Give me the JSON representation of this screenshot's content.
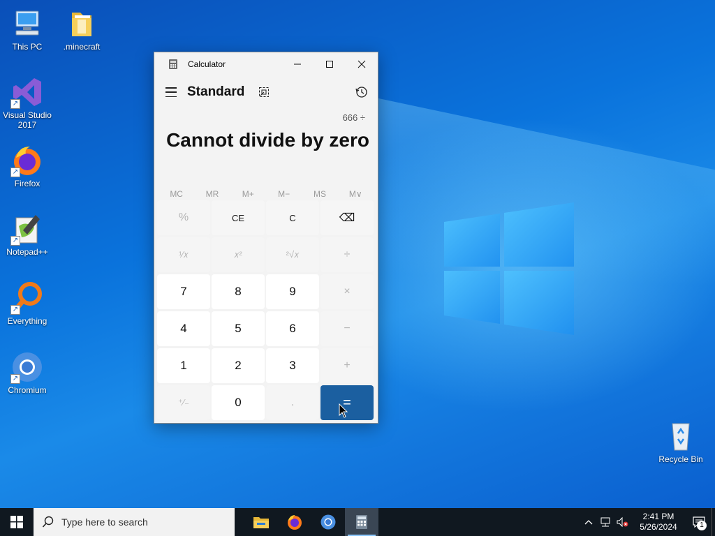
{
  "desktop": {
    "icons": [
      {
        "label": "This PC",
        "icon": "computer-icon"
      },
      {
        "label": ".minecraft",
        "icon": "folder-icon"
      },
      {
        "label": "Visual Studio 2017",
        "icon": "visual-studio-icon"
      },
      {
        "label": "Firefox",
        "icon": "firefox-icon"
      },
      {
        "label": "Notepad++",
        "icon": "notepadpp-icon"
      },
      {
        "label": "Everything",
        "icon": "everything-search-icon"
      },
      {
        "label": "Chromium",
        "icon": "chromium-icon"
      },
      {
        "label": "Recycle Bin",
        "icon": "recycle-bin-icon"
      }
    ]
  },
  "calculator": {
    "window_title": "Calculator",
    "mode": "Standard",
    "expression": "666 ÷",
    "result": "Cannot divide by zero",
    "memory": [
      "MC",
      "MR",
      "M+",
      "M−",
      "MS",
      "M∨"
    ],
    "keys": [
      {
        "label": "%",
        "state": "disabled"
      },
      {
        "label": "CE",
        "state": "enabled"
      },
      {
        "label": "C",
        "state": "enabled"
      },
      {
        "label": "⌫",
        "state": "enabled"
      },
      {
        "label": "¹⁄𝑥",
        "state": "disabled"
      },
      {
        "label": "𝑥²",
        "state": "disabled"
      },
      {
        "label": "²√𝑥",
        "state": "disabled"
      },
      {
        "label": "÷",
        "state": "disabled"
      },
      {
        "label": "7",
        "state": "number"
      },
      {
        "label": "8",
        "state": "number"
      },
      {
        "label": "9",
        "state": "number"
      },
      {
        "label": "×",
        "state": "disabled"
      },
      {
        "label": "4",
        "state": "number"
      },
      {
        "label": "5",
        "state": "number"
      },
      {
        "label": "6",
        "state": "number"
      },
      {
        "label": "−",
        "state": "disabled"
      },
      {
        "label": "1",
        "state": "number"
      },
      {
        "label": "2",
        "state": "number"
      },
      {
        "label": "3",
        "state": "number"
      },
      {
        "label": "+",
        "state": "disabled"
      },
      {
        "label": "⁺⁄₋",
        "state": "disabled"
      },
      {
        "label": "0",
        "state": "number"
      },
      {
        "label": ".",
        "state": "disabled"
      },
      {
        "label": "=",
        "state": "equals"
      }
    ]
  },
  "taskbar": {
    "search_placeholder": "Type here to search",
    "apps": [
      "file-explorer-icon",
      "firefox-icon",
      "chromium-icon",
      "calculator-icon"
    ],
    "time": "2:41 PM",
    "date": "5/26/2024",
    "notification_count": "1"
  },
  "colors": {
    "accent": "#1b5fa0",
    "taskbar": "#101820",
    "window_bg": "#f3f3f3"
  }
}
